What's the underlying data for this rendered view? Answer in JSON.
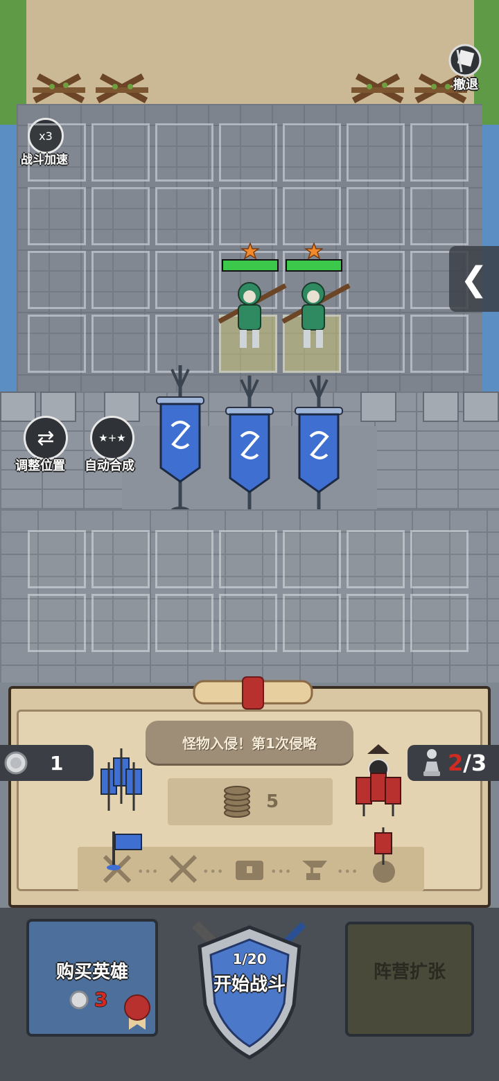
{
  "top_bar": {
    "retreat_label": "撤退",
    "speed_badge": "x3",
    "speed_label": "战斗加速"
  },
  "board": {
    "enemy_rows": 4,
    "enemy_cols": 7,
    "player_rows": 2,
    "player_cols": 7,
    "units": [
      {
        "type": "musketeer",
        "star_count": 1,
        "health_fraction": 1.0
      },
      {
        "type": "musketeer",
        "star_count": 1,
        "health_fraction": 1.0
      }
    ]
  },
  "side_controls": {
    "adjust_label": "调整位置",
    "auto_merge_label": "自动合成",
    "auto_merge_glyph": "★+★",
    "side_tab_glyph": "❮"
  },
  "panel": {
    "invasion_text": "怪物入侵！第1次侵略",
    "coins": "1",
    "army_current": "2",
    "army_max": "/3",
    "cost_value": "5",
    "dots": "•••"
  },
  "bottom": {
    "buy_label": "购买英雄",
    "buy_cost": "3",
    "battle_progress": "1/20",
    "start_label": "开始战斗",
    "expand_label": "阵营扩张"
  },
  "colors": {
    "accent_red": "#d02a22",
    "health_green": "#3cc84b",
    "banner_blue": "#3f6fd0",
    "enemy_red": "#b8312f"
  }
}
